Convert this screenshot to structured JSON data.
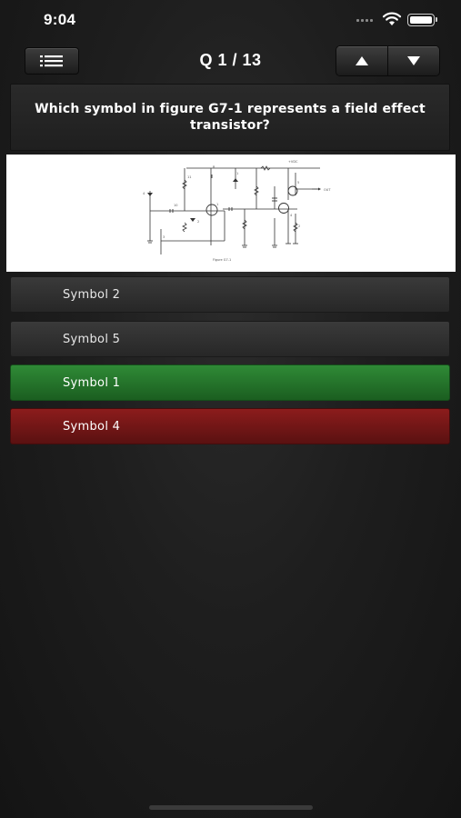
{
  "status_bar": {
    "time": "9:04"
  },
  "nav": {
    "question_counter": "Q 1 / 13"
  },
  "question": {
    "text": "Which symbol in figure G7-1 represents a field effect transistor?",
    "figure_caption": "Figure G7-1",
    "figure_labels": {
      "vcc": "+VDC",
      "out": "OUT"
    }
  },
  "answers": [
    {
      "label": "Symbol 2",
      "state": "neutral"
    },
    {
      "label": "Symbol 5",
      "state": "neutral"
    },
    {
      "label": "Symbol 1",
      "state": "correct"
    },
    {
      "label": "Symbol 4",
      "state": "wrong"
    }
  ],
  "colors": {
    "correct": "#2f8a36",
    "wrong": "#8c1c1c"
  }
}
